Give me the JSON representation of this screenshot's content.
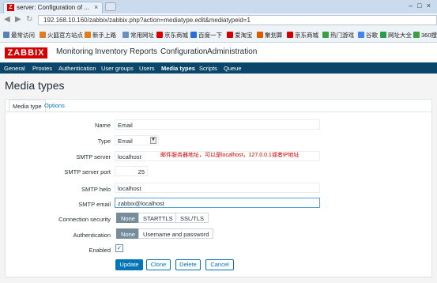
{
  "browser": {
    "tab_title": "server: Configuration of ...",
    "tab_close": "×",
    "url": "192.168.10.160/zabbix/zabbix.php?action=mediatype.edit&mediatypeid=1",
    "bookmarks": [
      "最常访问",
      "火狐官方站点",
      "新手上路",
      "常用网址",
      "京东商城",
      "百度一下",
      "爱淘宝",
      "聚划算",
      "京东商城",
      "热门游戏",
      "谷歌",
      "网址大全",
      "360搜"
    ]
  },
  "zabbix": {
    "logo": "ZABBIX",
    "menu": [
      "Monitoring",
      "Inventory",
      "Reports",
      "Configuration",
      "Administration"
    ],
    "submenu": [
      "General",
      "Proxies",
      "Authentication",
      "User groups",
      "Users",
      "Media types",
      "Scripts",
      "Queue"
    ],
    "page_title": "Media types"
  },
  "form": {
    "tabs": [
      "Media type",
      "Options"
    ],
    "name_label": "Name",
    "name_value": "Email",
    "type_label": "Type",
    "type_value": "Email",
    "smtp_server_label": "SMTP server",
    "smtp_server_value": "localhost",
    "smtp_port_label": "SMTP server port",
    "smtp_port_value": "25",
    "smtp_helo_label": "SMTP helo",
    "smtp_helo_value": "localhost",
    "smtp_email_label": "SMTP email",
    "smtp_email_value": "zabbix@localhost",
    "security_label": "Connection security",
    "security_options": [
      "None",
      "STARTTLS",
      "SSL/TLS"
    ],
    "auth_label": "Authentication",
    "auth_options": [
      "None",
      "Username and password"
    ],
    "enabled_label": "Enabled",
    "note": "邮件服务器地址，可以是localhost，127.0.0.1或者IP地址",
    "buttons": [
      "Update",
      "Clone",
      "Delete",
      "Cancel"
    ]
  }
}
